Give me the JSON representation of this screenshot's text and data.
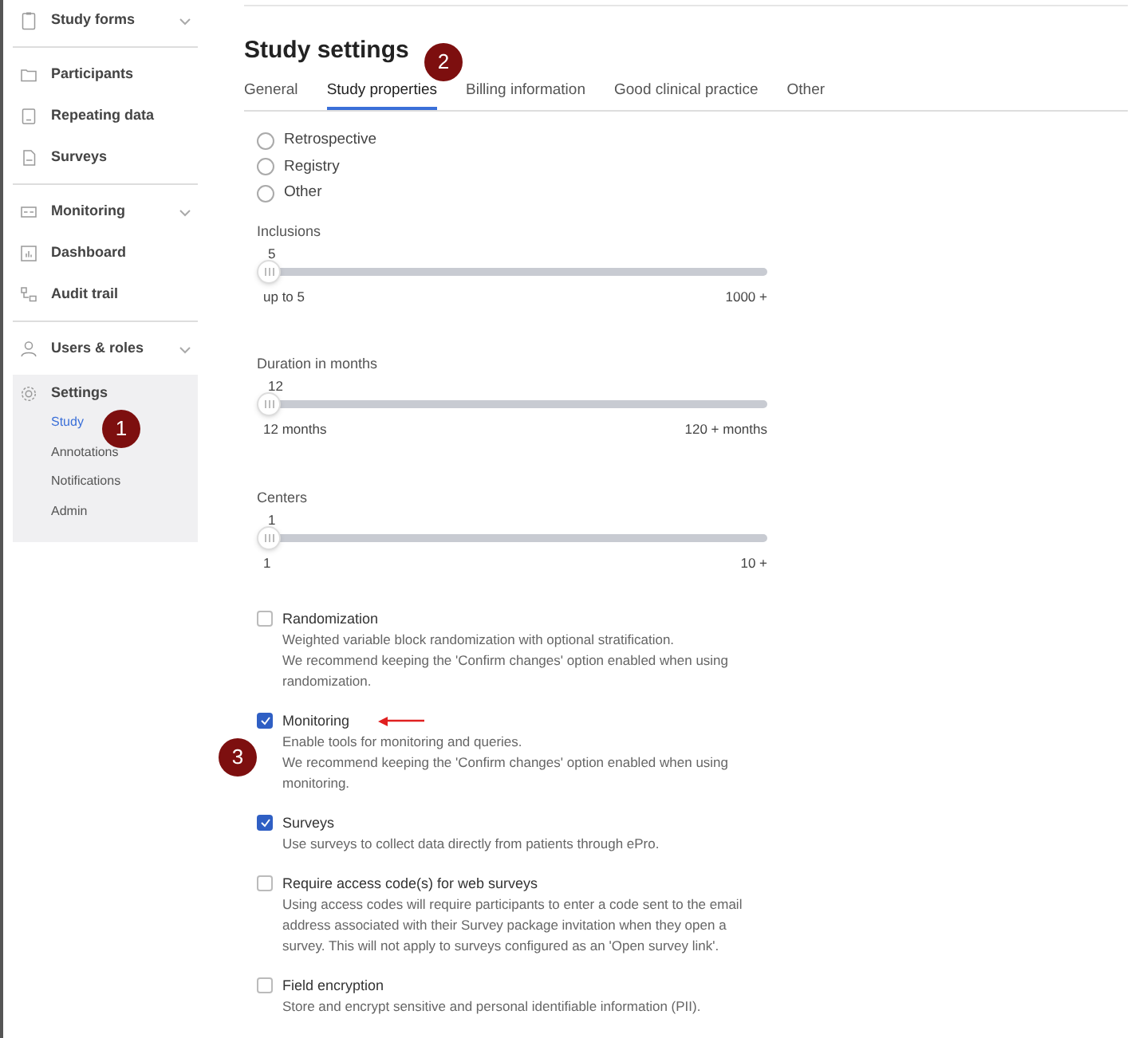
{
  "sidebar": {
    "groups": [
      {
        "items": [
          {
            "label": "Study forms",
            "expandable": true
          }
        ]
      },
      {
        "items": [
          {
            "label": "Participants",
            "expandable": false
          },
          {
            "label": "Repeating data",
            "expandable": false
          },
          {
            "label": "Surveys",
            "expandable": false
          }
        ]
      },
      {
        "items": [
          {
            "label": "Monitoring",
            "expandable": true
          },
          {
            "label": "Dashboard",
            "expandable": false
          },
          {
            "label": "Audit trail",
            "expandable": false
          }
        ]
      },
      {
        "items": [
          {
            "label": "Users & roles",
            "expandable": true
          }
        ]
      }
    ],
    "settings": {
      "label": "Settings",
      "children": [
        {
          "label": "Study",
          "selected": true
        },
        {
          "label": "Annotations",
          "selected": false
        },
        {
          "label": "Notifications",
          "selected": false
        },
        {
          "label": "Admin",
          "selected": false
        }
      ]
    }
  },
  "title": "Study settings",
  "tabs": [
    {
      "label": "General",
      "selected": false
    },
    {
      "label": "Study properties",
      "selected": true
    },
    {
      "label": "Billing information",
      "selected": false
    },
    {
      "label": "Good clinical practice",
      "selected": false
    },
    {
      "label": "Other",
      "selected": false
    }
  ],
  "study_types": [
    {
      "label": "Retrospective",
      "selected": false
    },
    {
      "label": "Registry",
      "selected": false
    },
    {
      "label": "Other",
      "selected": false
    }
  ],
  "sliders": [
    {
      "label": "Inclusions",
      "value": "5",
      "level": 0,
      "min_label": "up to 5",
      "max_label": "1000 +"
    },
    {
      "label": "Duration in months",
      "value": "12",
      "level": 0,
      "min_label": "12 months",
      "max_label": "120 + months"
    },
    {
      "label": "Centers",
      "value": "1",
      "level": 0,
      "min_label": "1",
      "max_label": "10 +"
    }
  ],
  "options": [
    {
      "label": "Randomization",
      "checked": false,
      "description": [
        "Weighted variable block randomization with optional stratification.",
        "We recommend keeping the 'Confirm changes' option enabled when using randomization."
      ]
    },
    {
      "label": "Monitoring",
      "checked": true,
      "description": [
        "Enable tools for monitoring and queries.",
        "We recommend keeping the 'Confirm changes' option enabled when using monitoring."
      ]
    },
    {
      "label": "Surveys",
      "checked": true,
      "description": [
        "Use surveys to collect data directly from patients through ePro."
      ]
    },
    {
      "label": "Require access code(s) for web surveys",
      "checked": false,
      "description": [
        "Using access codes will require participants to enter a code sent to the email address associated with their Survey package invitation when they open a survey. This will not apply to surveys configured as an 'Open survey link'."
      ]
    },
    {
      "label": "Field encryption",
      "checked": false,
      "description": [
        "Store and encrypt sensitive and personal identifiable information (PII)."
      ]
    }
  ],
  "annotations": [
    {
      "label": "1"
    },
    {
      "label": "2"
    },
    {
      "label": "3"
    }
  ]
}
